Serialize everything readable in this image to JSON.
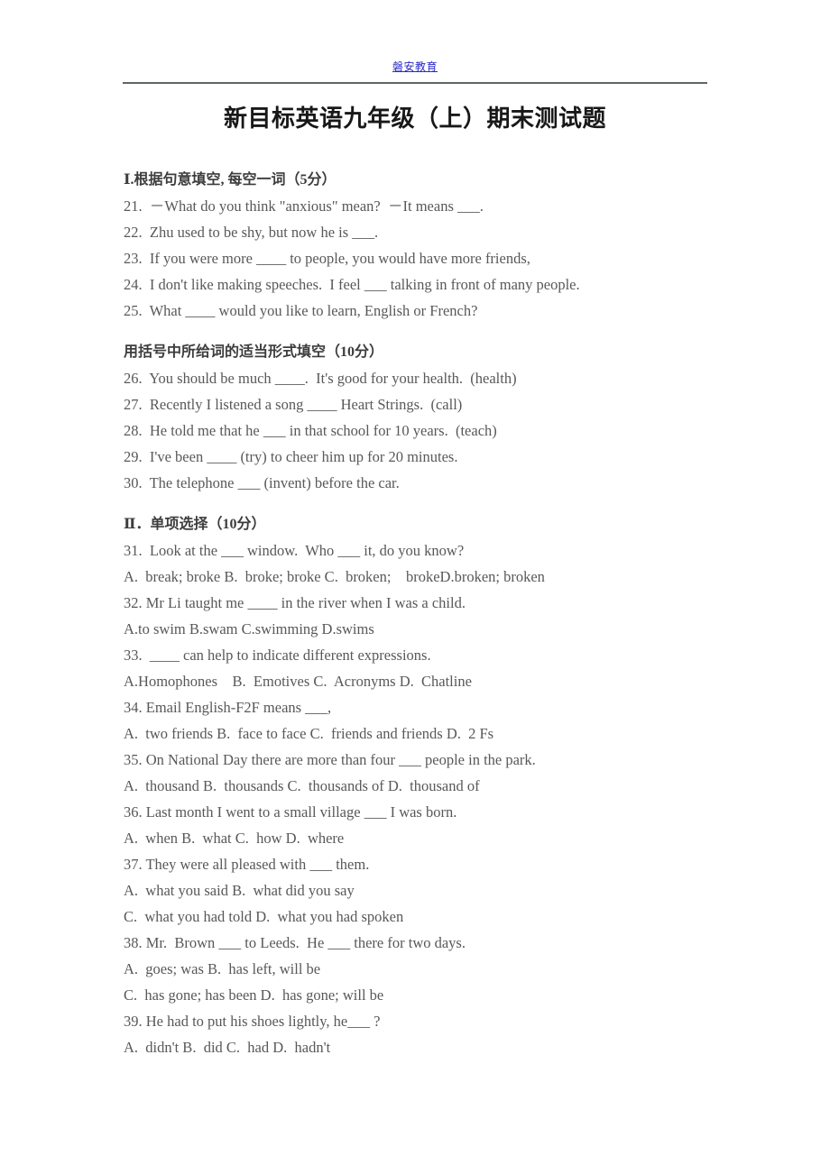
{
  "header": {
    "link_text": "磐安教育",
    "link_color": "#2b2bc8",
    "rule_color": "#5f6660"
  },
  "title": "新目标英语九年级（上）期末测试题",
  "sections": [
    {
      "heading": "Ⅰ.根据句意填空, 每空一词（5分）",
      "lines": [
        "21.  －What do you think \"anxious\" mean?  －It means ___.",
        "22.  Zhu used to be shy, but now he is ___.",
        "23.  If you were more ____ to people, you would have more friends,",
        "24.  I don't like making speeches.  I feel ___ talking in front of many people.",
        "25.  What ____ would you like to learn, English or French?"
      ]
    },
    {
      "heading": "用括号中所给词的适当形式填空（10分）",
      "lines": [
        "26.  You should be much ____.  It's good for your health.  (health)",
        "27.  Recently I listened a song ____ Heart Strings.  (call)",
        "28.  He told me that he ___ in that school for 10 years.  (teach)",
        "29.  I've been ____ (try) to cheer him up for 20 minutes.",
        "30.  The telephone ___ (invent) before the car."
      ]
    },
    {
      "heading": "Ⅱ．单项选择（10分）",
      "lines": [
        "31.  Look at the ___ window.  Who ___ it, do you know?",
        "A.  break; broke B.  broke; broke C.  broken;    brokeD.broken; broken",
        "32. Mr Li taught me ____ in the river when I was a child.",
        "A.to swim B.swam C.swimming D.swims",
        "33.  ____ can help to indicate different expressions.",
        "A.Homophones    B.  Emotives C.  Acronyms D.  Chatline",
        "34. Email English-F2F means ___,",
        "A.  two friends B.  face to face C.  friends and friends D.  2 Fs",
        "35. On National Day there are more than four ___ people in the park.",
        "A.  thousand B.  thousands C.  thousands of D.  thousand of",
        "36. Last month I went to a small village ___ I was born.",
        "A.  when B.  what C.  how D.  where",
        "37. They were all pleased with ___ them.",
        "A.  what you said B.  what did you say",
        "C.  what you had told D.  what you had spoken",
        "38. Mr.  Brown ___ to Leeds.  He ___ there for two days.",
        "A.  goes; was B.  has left, will be",
        "C.  has gone; has been D.  has gone; will be",
        "39. He had to put his shoes lightly, he___ ?",
        "A.  didn't B.  did C.  had D.  hadn't"
      ]
    }
  ]
}
